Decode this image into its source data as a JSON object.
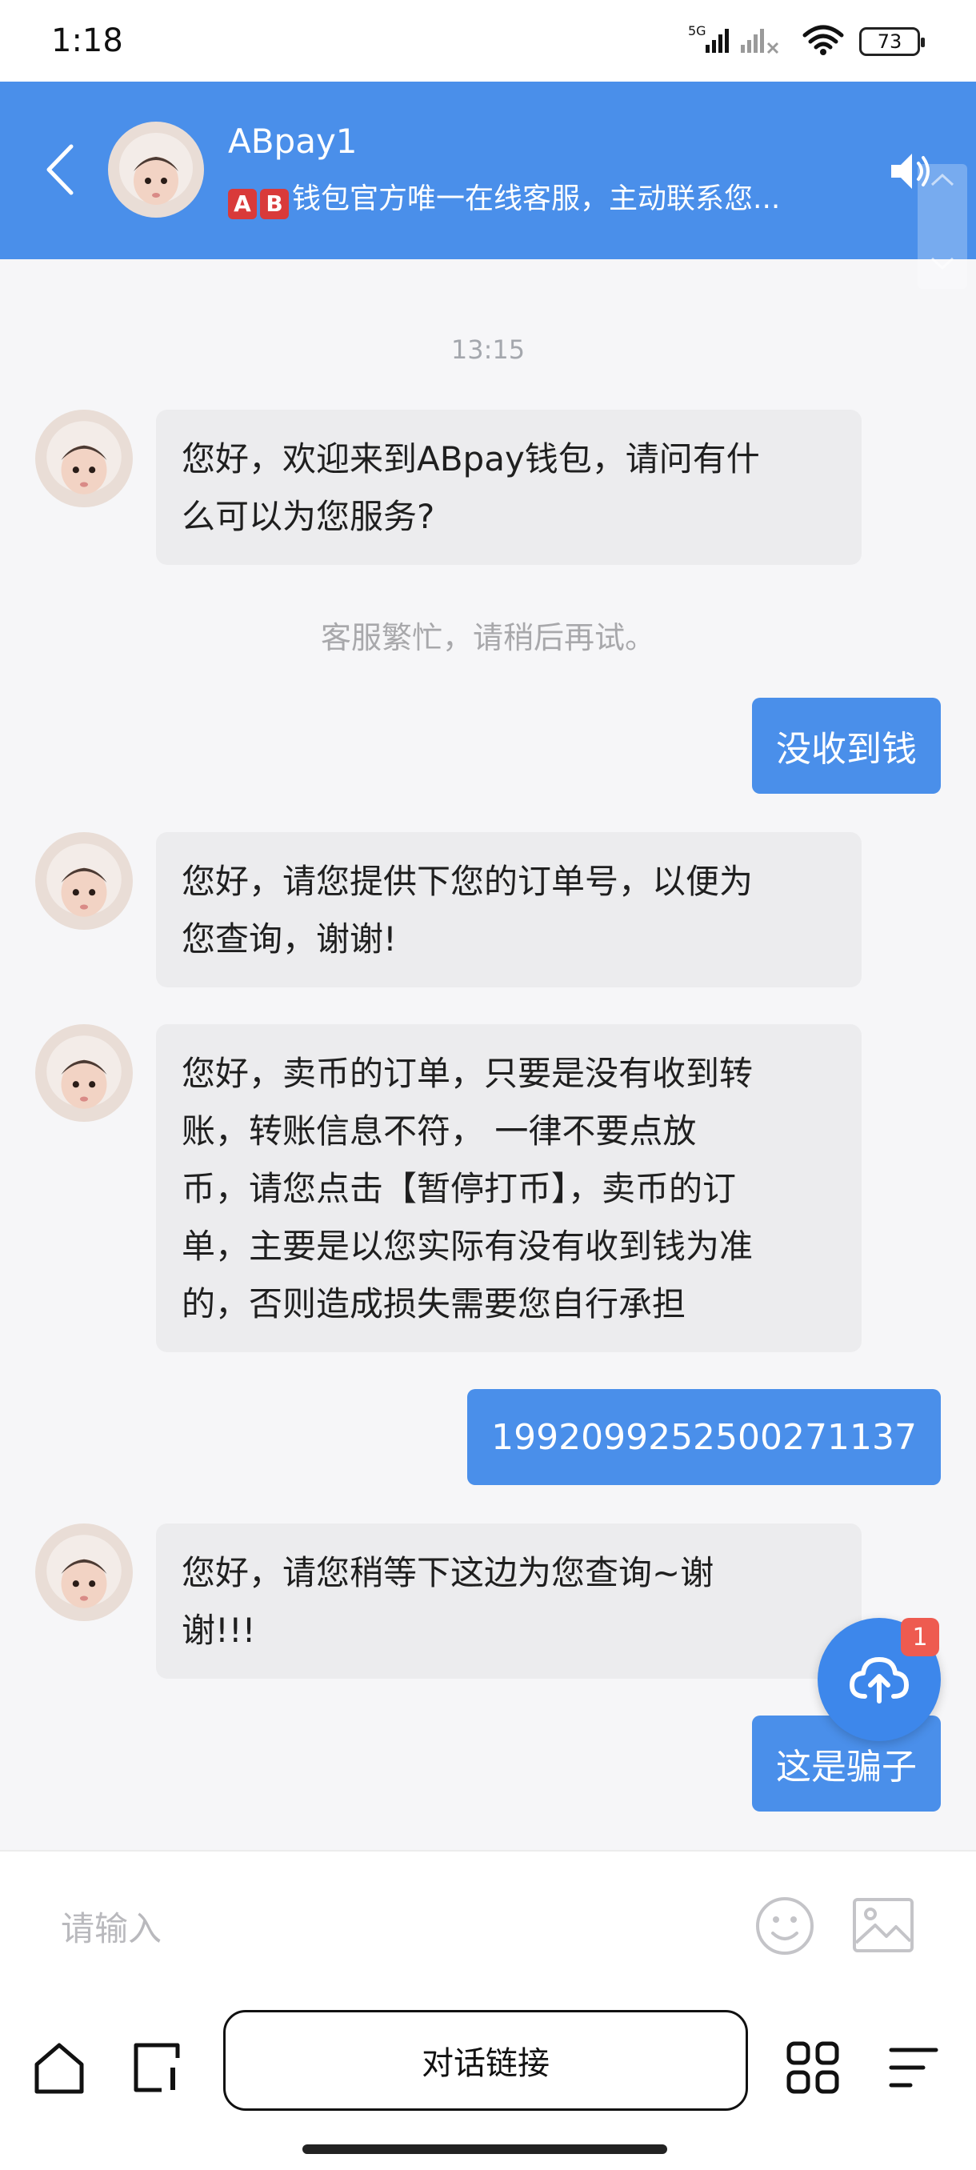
{
  "status_bar": {
    "time": "1:18",
    "network": "5G",
    "battery": "73"
  },
  "header": {
    "title": "ABpay1",
    "badge_a": "A",
    "badge_b": "B",
    "subtitle": "钱包官方唯一在线客服，主动联系您..."
  },
  "chat": {
    "timestamp": "13:15",
    "notice": "客服繁忙，请稍后再试。",
    "messages": [
      {
        "side": "in",
        "lines": [
          "您好，欢迎来到ABpay钱包，请问有什",
          "么可以为您服务?"
        ]
      },
      {
        "side": "out",
        "text": "没收到钱"
      },
      {
        "side": "in",
        "lines": [
          "您好，请您提供下您的订单号，以便为",
          "您查询，谢谢!"
        ]
      },
      {
        "side": "in",
        "lines": [
          "您好，卖币的订单，只要是没有收到转",
          "账，转账信息不符， 一律不要点放",
          "币，请您点击【暂停打币】，卖币的订",
          "单，主要是以您实际有没有收到钱为准",
          "的，否则造成损失需要您自行承担"
        ]
      },
      {
        "side": "out",
        "text": "1992099252500271137"
      },
      {
        "side": "in",
        "lines": [
          "您好，请您稍等下这边为您查询~谢",
          "谢!!!"
        ]
      },
      {
        "side": "out",
        "text": "这是骗子"
      }
    ]
  },
  "upload_fab": {
    "badge_count": "1"
  },
  "input": {
    "placeholder": "请输入",
    "value": ""
  },
  "nav": {
    "chat_link_label": "对话链接"
  },
  "colors": {
    "accent": "#4a8fea",
    "badge": "#ee5b50",
    "incoming_bubble": "#ececee",
    "background": "#f6f6f8"
  },
  "icons": [
    "signal-icon",
    "wifi-icon",
    "battery-icon",
    "back-icon",
    "volume-icon",
    "scroll-up-icon",
    "scroll-down-icon",
    "upload-cloud-icon",
    "emoji-icon",
    "image-icon",
    "home-icon",
    "tab-icon",
    "apps-grid-icon",
    "menu-icon"
  ]
}
